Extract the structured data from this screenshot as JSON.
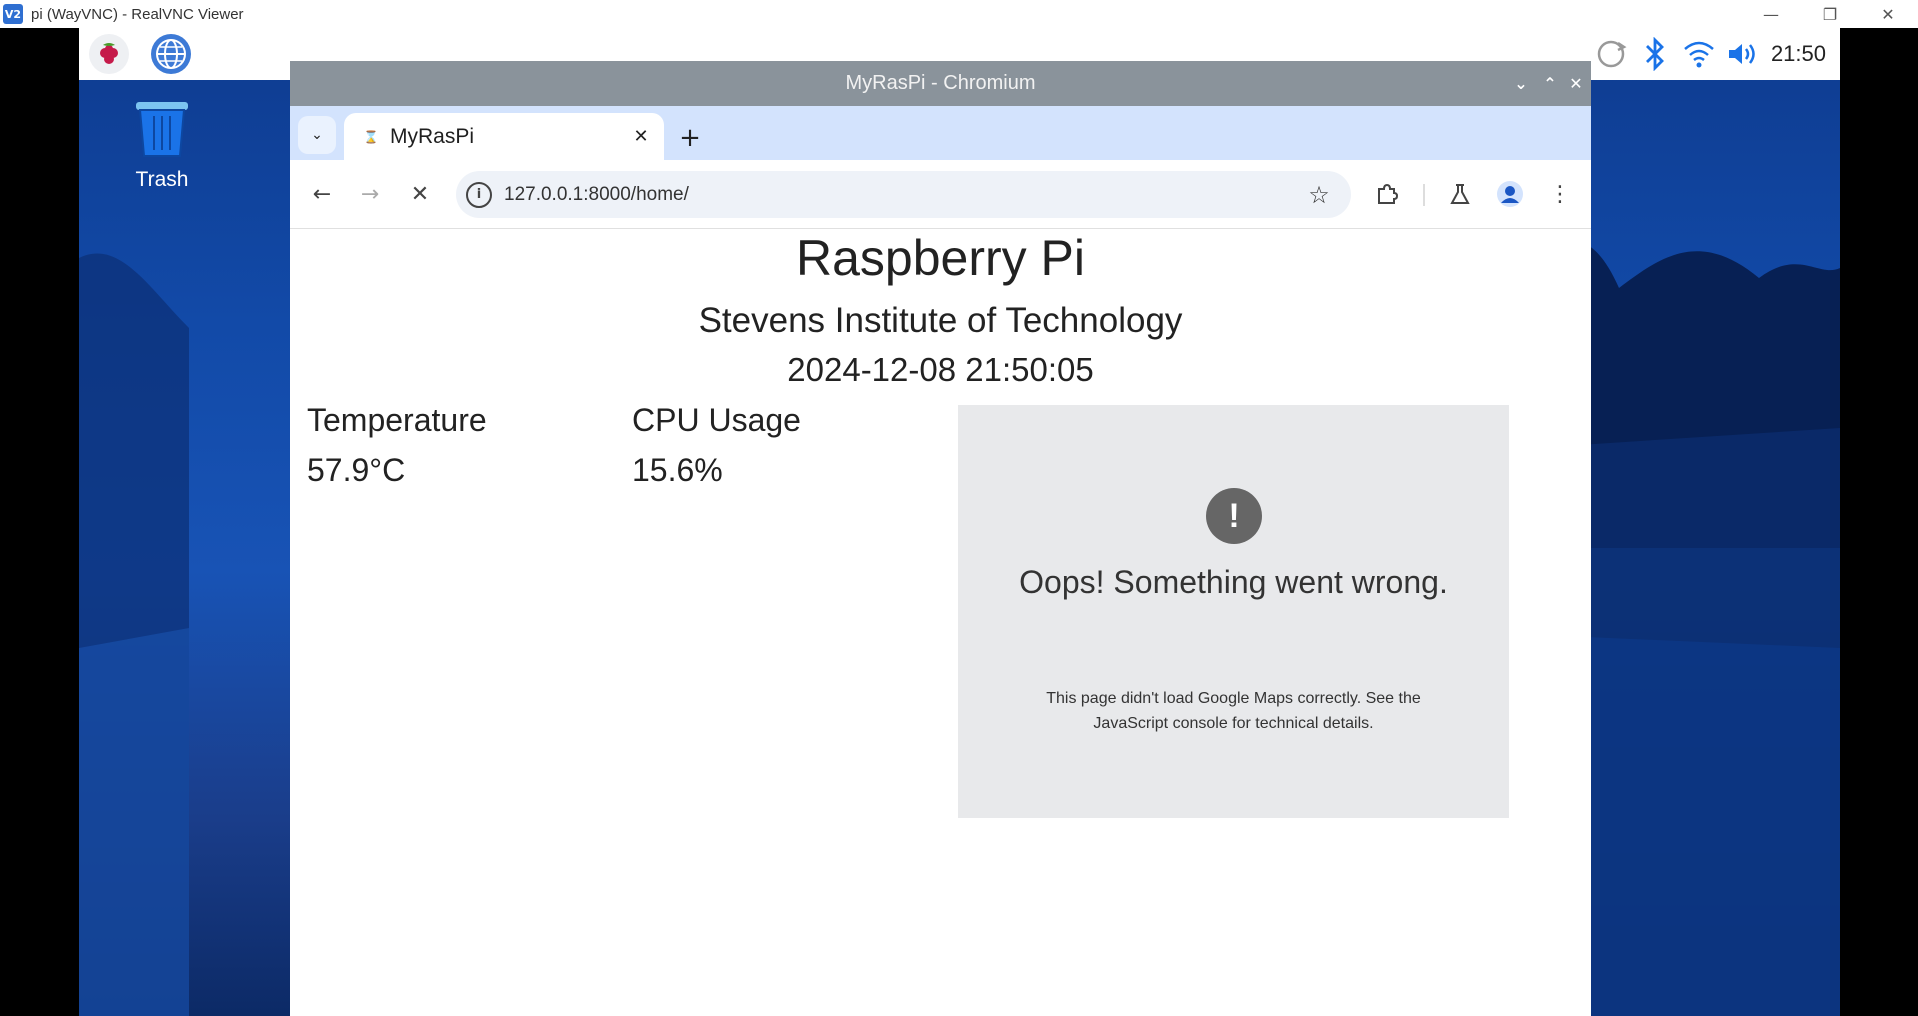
{
  "vnc": {
    "title": "pi (WayVNC) - RealVNC Viewer",
    "minimize": "—",
    "restore": "❐",
    "close": "✕"
  },
  "taskbar": {
    "clock": "21:50"
  },
  "desktop": {
    "trash_label": "Trash"
  },
  "chromium": {
    "window_title": "MyRasPi - Chromium",
    "tab_title": "MyRasPi",
    "url": "127.0.0.1:8000/home/"
  },
  "page": {
    "title": "Raspberry Pi",
    "subtitle": "Stevens Institute of Technology",
    "datetime": "2024-12-08 21:50:05",
    "temperature_label": "Temperature",
    "temperature_value": "57.9°C",
    "cpu_label": "CPU Usage",
    "cpu_value": "15.6%",
    "map_error_title": "Oops! Something went wrong.",
    "map_error_text": "This page didn't load Google Maps correctly. See the JavaScript console for technical details."
  },
  "colors": {
    "desktop_blue": "#124aa8",
    "chrome_titlebar": "#8a939b",
    "tabstrip": "#d3e3fd",
    "accent": "#1a73e8"
  }
}
